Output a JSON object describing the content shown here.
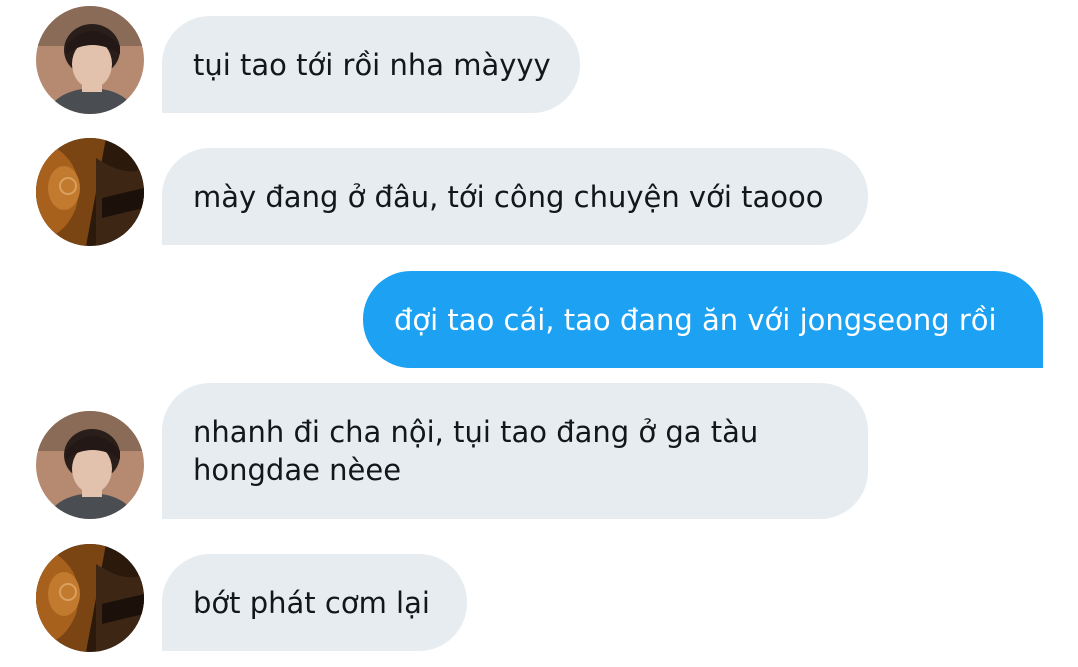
{
  "colors": {
    "incoming_bubble": "#e6ecf0",
    "outgoing_bubble": "#1da1f2",
    "incoming_text": "#14171a",
    "outgoing_text": "#ffffff"
  },
  "messages": [
    {
      "direction": "incoming",
      "avatar": "avatar-boy",
      "text": "tụi tao tới rồi nha màyyy"
    },
    {
      "direction": "incoming",
      "avatar": "avatar-dark-photo",
      "text": "mày đang ở đâu, tới công chuyện với taooo"
    },
    {
      "direction": "outgoing",
      "text": "đợi tao cái, tao đang ăn với jongseong rồi"
    },
    {
      "direction": "incoming",
      "avatar": "avatar-boy",
      "text": "nhanh đi cha nội, tụi tao đang ở ga tàu hongdae nèee"
    },
    {
      "direction": "incoming",
      "avatar": "avatar-dark-photo",
      "text": "bớt phát cơm lại"
    }
  ]
}
